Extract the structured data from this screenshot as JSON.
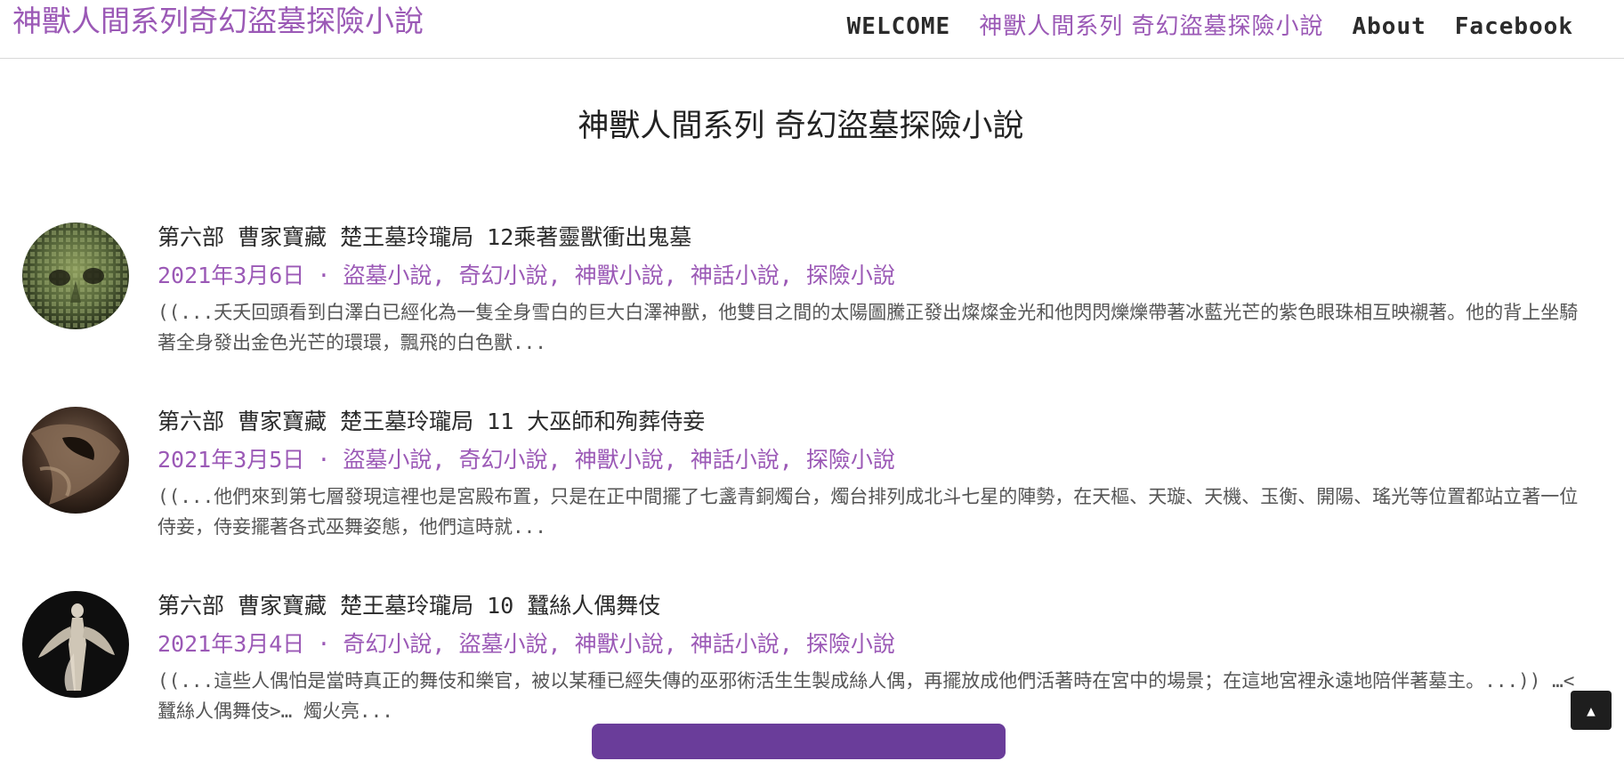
{
  "header": {
    "site_title": "神獸人間系列奇幻盜墓探險小說",
    "nav": [
      {
        "label": "WELCOME"
      },
      {
        "label": "神獸人間系列 奇幻盜墓探險小說"
      },
      {
        "label": "About"
      },
      {
        "label": "Facebook"
      }
    ]
  },
  "main": {
    "page_title": "神獸人間系列 奇幻盜墓探險小說",
    "posts": [
      {
        "title": "第六部 曹家寶藏 楚王墓玲瓏局 12乘著靈獸衝出鬼墓",
        "date": "2021年3月6日",
        "separator": "·",
        "categories": [
          "盜墓小說",
          "奇幻小說",
          "神獸小說",
          "神話小說",
          "探險小說"
        ],
        "excerpt": "((...夭夭回頭看到白澤白已經化為一隻全身雪白的巨大白澤神獸，他雙目之間的太陽圖騰正發出燦燦金光和他閃閃爍爍帶著冰藍光芒的紫色眼珠相互映襯著。他的背上坐騎著全身發出金色光芒的環環，飄飛的白色獸..."
      },
      {
        "title": "第六部 曹家寶藏 楚王墓玲瓏局 11 大巫師和殉葬侍妾",
        "date": "2021年3月5日",
        "separator": "·",
        "categories": [
          "盜墓小說",
          "奇幻小說",
          "神獸小說",
          "神話小說",
          "探險小說"
        ],
        "excerpt": "((...他們來到第七層發現這裡也是宮殿布置，只是在正中間擺了七盞青銅燭台，燭台排列成北斗七星的陣勢，在天樞、天璇、天機、玉衡、開陽、瑤光等位置都站立著一位侍妾，侍妾擺著各式巫舞姿態，他們這時就..."
      },
      {
        "title": "第六部 曹家寶藏 楚王墓玲瓏局 10 蠶絲人偶舞伎",
        "date": "2021年3月4日",
        "separator": "·",
        "categories": [
          "奇幻小說",
          "盜墓小說",
          "神獸小說",
          "神話小說",
          "探險小說"
        ],
        "excerpt": "((...這些人偶怕是當時真正的舞伎和樂官，被以某種已經失傳的巫邪術活生生製成絲人偶，再擺放成他們活著時在宮中的場景；在這地宮裡永遠地陪伴著墓主。...)) …<蠶絲人偶舞伎>… 燭火亮..."
      }
    ]
  },
  "back_to_top": {
    "icon": "arrow-up-icon",
    "glyph": "▲"
  },
  "colors": {
    "accent": "#9b59b6",
    "button": "#6a3d9a"
  }
}
